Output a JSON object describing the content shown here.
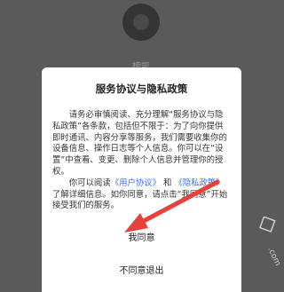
{
  "background": {
    "app_label": "榜凯"
  },
  "dialog": {
    "title": "服务协议与隐私政策",
    "paragraph1": "请务必审慎阅读、充分理解“服务协议与隐私政策”各条款，包括但不限于：为了向你提供即时通讯、内容分享等服务，我们需要收集你的设备信息、操作日志等个人信息。你可以在“设置”中查看、变更、删除个人信息并管理你的授权。",
    "paragraph2_prefix": "你可以阅读",
    "user_agreement_link": "《用户协议》",
    "and": "和",
    "privacy_policy_link": "《隐私政策》",
    "paragraph2_suffix": "了解详细信息。如你同意，请点击“我同意”开始接受我们的服务。",
    "agree_label": "我同意",
    "disagree_label": "不同意退出"
  },
  "colors": {
    "overlay": "#5a5a5a",
    "link": "#3d6de0",
    "arrow": "#e8403a"
  },
  "icons": {
    "arrow": "red-arrow-icon",
    "app_logo": "app-logo-icon",
    "watermark": "watermark-icon"
  }
}
